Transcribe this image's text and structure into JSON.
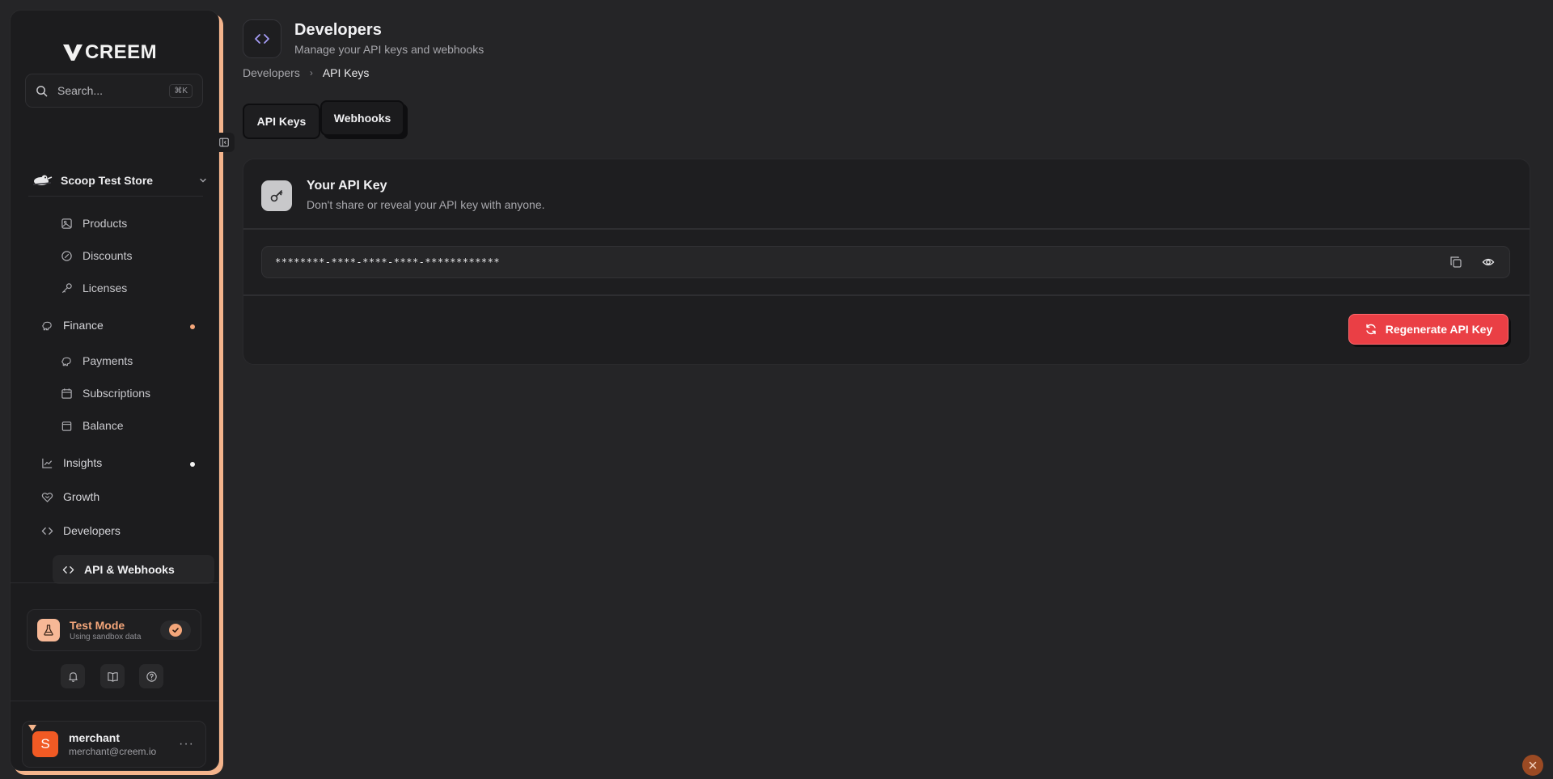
{
  "brand": {
    "name": "CREEM"
  },
  "search": {
    "placeholder": "Search...",
    "shortcut": "⌘K"
  },
  "store": {
    "name": "Scoop Test Store"
  },
  "sidebar": {
    "products": "Products",
    "discounts": "Discounts",
    "licenses": "Licenses",
    "finance": "Finance",
    "payments": "Payments",
    "subscriptions": "Subscriptions",
    "balance": "Balance",
    "insights": "Insights",
    "growth": "Growth",
    "developers": "Developers",
    "api_webhooks": "API & Webhooks"
  },
  "test_mode": {
    "title": "Test Mode",
    "subtitle": "Using sandbox data",
    "enabled": true
  },
  "account": {
    "initial": "S",
    "name": "merchant",
    "email": "merchant@creem.io"
  },
  "header": {
    "title": "Developers",
    "subtitle": "Manage your API keys and webhooks"
  },
  "breadcrumb": {
    "parent": "Developers",
    "current": "API Keys"
  },
  "tabs": {
    "api_keys": "API Keys",
    "webhooks": "Webhooks"
  },
  "api_key_card": {
    "title": "Your API Key",
    "subtitle": "Don't share or reveal your API key with anyone.",
    "masked_key": "********-****-****-****-************",
    "regenerate_label": "Regenerate API Key"
  },
  "colors": {
    "accent": "#f4b48c",
    "danger": "#ea3f45",
    "avatar": "#f15a24",
    "notification_dot": "#f4a67a"
  }
}
